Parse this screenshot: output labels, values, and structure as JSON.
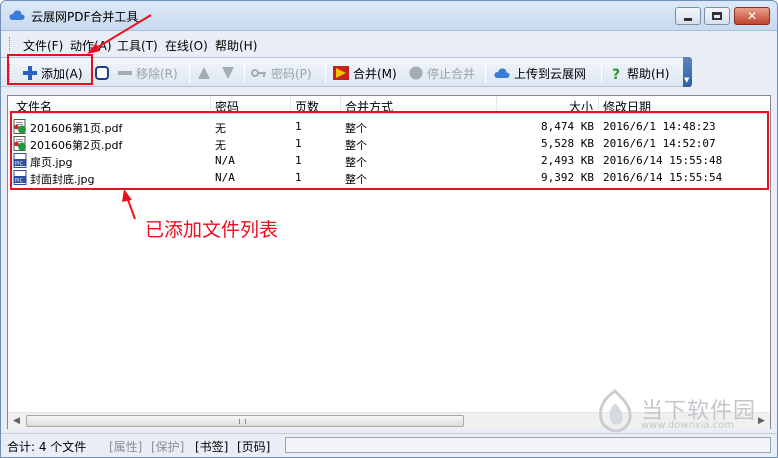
{
  "window": {
    "title": "云展网PDF合并工具"
  },
  "menu": [
    "文件(F)",
    "动作(A)",
    "工具(T)",
    "在线(O)",
    "帮助(H)"
  ],
  "toolbar": {
    "add": "添加(A)",
    "remove": "移除(R)",
    "password": "密码(P)",
    "merge": "合并(M)",
    "stop": "停止合并",
    "upload": "上传到云展网",
    "help": "帮助(H)"
  },
  "table": {
    "columns": [
      "文件名",
      "密码",
      "页数",
      "合并方式",
      "大小",
      "修改日期"
    ],
    "rows": [
      {
        "icon": "pdf-icon",
        "name": "201606第1页.pdf",
        "password": "无",
        "pages": "1",
        "mode": "整个",
        "size": "8,474 KB",
        "modified": "2016/6/1 14:48:23"
      },
      {
        "icon": "pdf-icon",
        "name": "201606第2页.pdf",
        "password": "无",
        "pages": "1",
        "mode": "整个",
        "size": "5,528 KB",
        "modified": "2016/6/1 14:52:07"
      },
      {
        "icon": "jpg-icon",
        "name": "扉页.jpg",
        "password": "N/A",
        "pages": "1",
        "mode": "整个",
        "size": "2,493 KB",
        "modified": "2016/6/14 15:55:48"
      },
      {
        "icon": "jpg-icon",
        "name": "封面封底.jpg",
        "password": "N/A",
        "pages": "1",
        "mode": "整个",
        "size": "9,392 KB",
        "modified": "2016/6/14 15:55:54"
      }
    ]
  },
  "status": {
    "total": "合计: 4 个文件",
    "attr": "[属性]",
    "protect": "[保护]",
    "bookmark": "[书签]",
    "pagecode": "[页码]"
  },
  "annotation": {
    "label": "已添加文件列表",
    "color": "#e8101e"
  },
  "watermark": {
    "brand": "当下软件园",
    "url": "www.downxia.com"
  },
  "colors": {
    "accent": "#2d5ea4",
    "annotation": "#e8101e"
  }
}
